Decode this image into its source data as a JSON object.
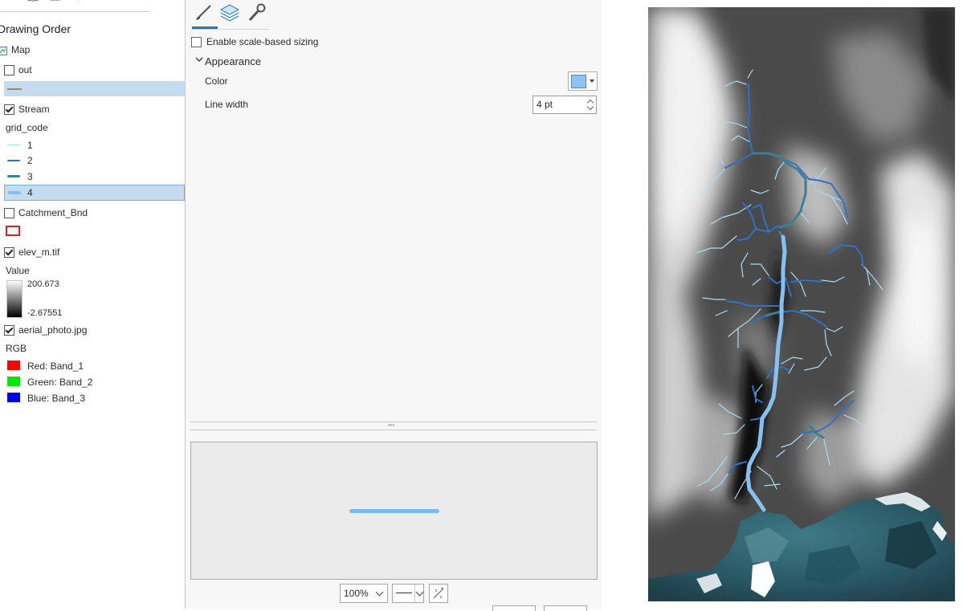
{
  "contents": {
    "title": "Drawing Order",
    "map_label": "Map",
    "layers": {
      "out": {
        "label": "out",
        "visible": false
      },
      "stream": {
        "label": "Stream",
        "visible": true,
        "field": "grid_code"
      },
      "catchment": {
        "label": "Catchment_Bnd",
        "visible": false
      },
      "elev": {
        "label": "elev_m.tif",
        "visible": true,
        "value_label": "Value",
        "max": "200.673",
        "min": "-2.67551"
      },
      "aerial": {
        "label": "aerial_photo.jpg",
        "visible": true,
        "rgb_label": "RGB"
      }
    },
    "stream_classes": [
      {
        "label": "1",
        "color": "#a6dcf5"
      },
      {
        "label": "2",
        "color": "#2f72c4"
      },
      {
        "label": "3",
        "color": "#3f7f92"
      },
      {
        "label": "4",
        "color": "#86bff0"
      }
    ],
    "rgb_bands": [
      {
        "label": "Red:  Band_1",
        "color": "#ff0000"
      },
      {
        "label": "Green:  Band_2",
        "color": "#00e600"
      },
      {
        "label": "Blue:  Band_3",
        "color": "#0000ee"
      }
    ]
  },
  "symbology": {
    "tabs": [
      "paintbrush-icon",
      "layers-icon",
      "wrench-icon"
    ],
    "scale_sizing_label": "Enable scale-based sizing",
    "scale_sizing_checked": false,
    "appearance_label": "Appearance",
    "color_label": "Color",
    "color_value": "#8dc3f2",
    "linewidth_label": "Line width",
    "linewidth_value": "4 pt",
    "zoom_value": "100%"
  }
}
